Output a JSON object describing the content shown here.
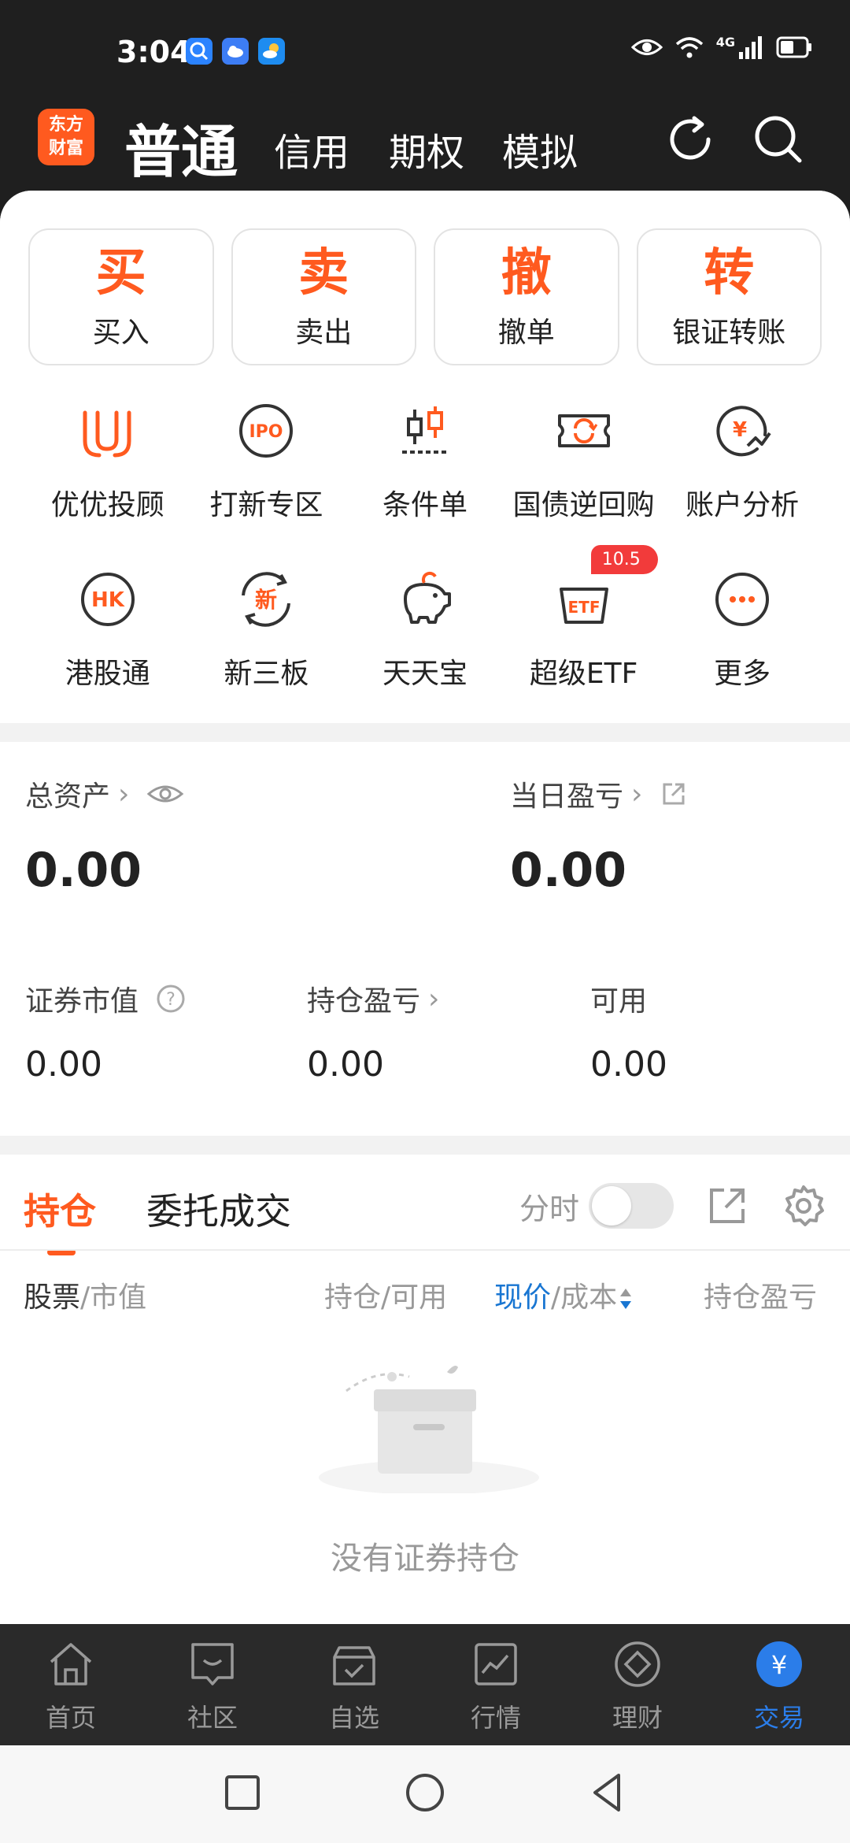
{
  "status_bar": {
    "time": "3:04",
    "network": "4G"
  },
  "header": {
    "logo_text": "东方财富",
    "account_tabs": [
      "普通",
      "信用",
      "期权",
      "模拟"
    ]
  },
  "quick_actions": [
    {
      "char": "买",
      "label": "买入"
    },
    {
      "char": "卖",
      "label": "卖出"
    },
    {
      "char": "撤",
      "label": "撤单"
    },
    {
      "char": "转",
      "label": "银证转账"
    }
  ],
  "services_row1": [
    {
      "icon": "uu-advisor-icon",
      "label": "优优投顾"
    },
    {
      "icon": "ipo-icon",
      "label": "打新专区"
    },
    {
      "icon": "candlestick-icon",
      "label": "条件单"
    },
    {
      "icon": "repo-icon",
      "label": "国债逆回购"
    },
    {
      "icon": "analysis-icon",
      "label": "账户分析"
    }
  ],
  "services_row2": [
    {
      "icon": "hk-icon",
      "label": "港股通"
    },
    {
      "icon": "new-board-icon",
      "label": "新三板"
    },
    {
      "icon": "piggy-bank-icon",
      "label": "天天宝"
    },
    {
      "icon": "etf-icon",
      "label": "超级ETF",
      "badge": "10.5"
    },
    {
      "icon": "more-icon",
      "label": "更多"
    }
  ],
  "assets": {
    "total_label": "总资产",
    "total_value": "0.00",
    "daily_pl_label": "当日盈亏",
    "daily_pl_value": "0.00",
    "market_value_label": "证券市值",
    "market_value": "0.00",
    "position_pl_label": "持仓盈亏",
    "position_pl_value": "0.00",
    "available_label": "可用",
    "available_value": "0.00"
  },
  "positions": {
    "tabs": [
      "持仓",
      "委托成交"
    ],
    "fenshi_label": "分时",
    "toggle_on": false,
    "columns": {
      "stock": "股票",
      "market_value": "/市值",
      "hold": "持仓/可用",
      "price": "现价",
      "cost": "/成本",
      "pl": "持仓盈亏"
    },
    "empty_text": "没有证券持仓"
  },
  "bottom_nav": [
    {
      "icon": "home-icon",
      "label": "首页"
    },
    {
      "icon": "community-icon",
      "label": "社区"
    },
    {
      "icon": "watchlist-icon",
      "label": "自选"
    },
    {
      "icon": "market-icon",
      "label": "行情"
    },
    {
      "icon": "wealth-icon",
      "label": "理财"
    },
    {
      "icon": "trade-icon",
      "label": "交易",
      "active": true
    }
  ],
  "colors": {
    "accent": "#ff5a1f",
    "active_blue": "#2b7de9",
    "badge_red": "#f23b3b"
  }
}
